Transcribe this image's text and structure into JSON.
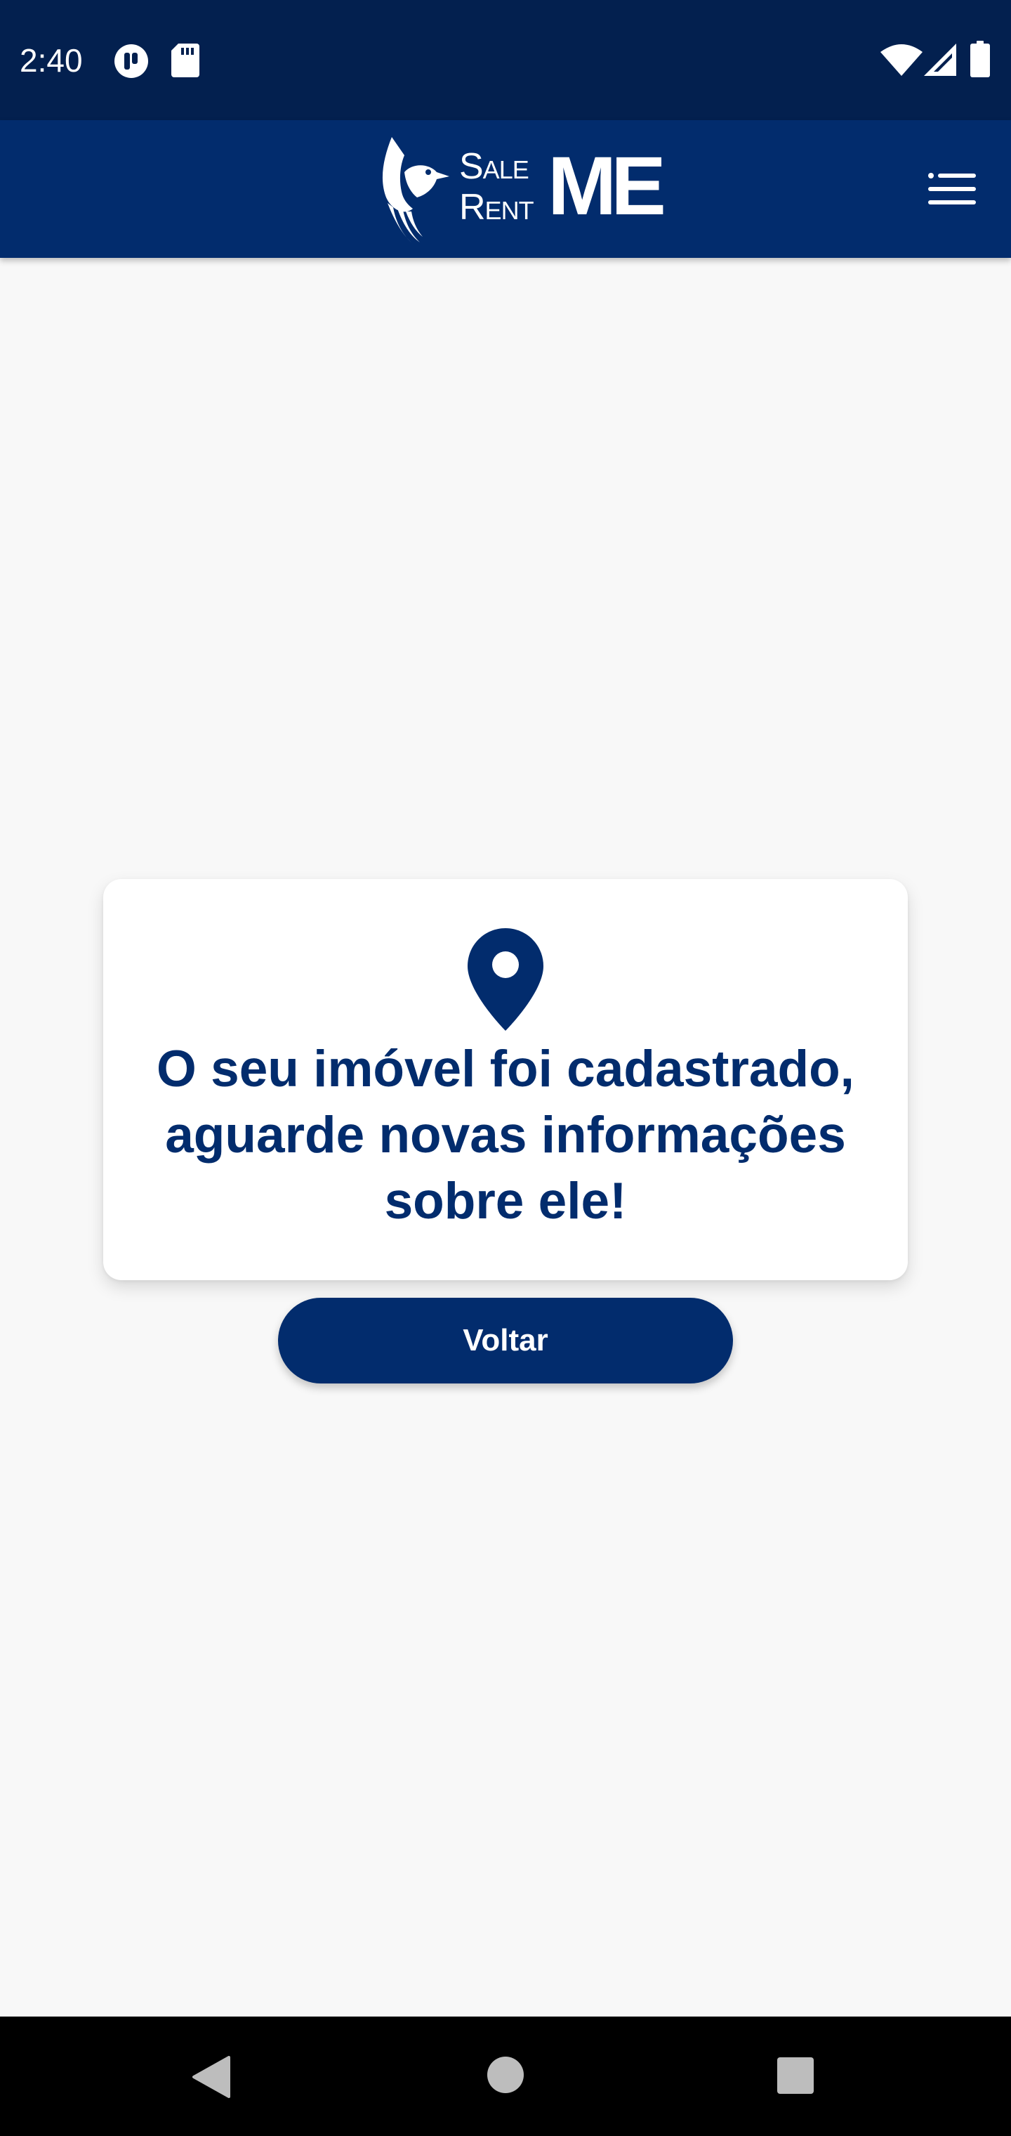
{
  "status_bar": {
    "time": "2:40",
    "left_icons": [
      "pause-circle-icon",
      "sd-card-icon"
    ],
    "right_icons": [
      "wifi-icon",
      "cell-signal-icon",
      "battery-icon"
    ]
  },
  "app_bar": {
    "logo": {
      "line1": "Sale",
      "line2": "Rent",
      "mark": "ME",
      "icon": "hummingbird-logo-icon"
    },
    "menu_icon": "menu-icon"
  },
  "card": {
    "icon": "location-pin-icon",
    "message": "O seu imóvel foi cadastrado, aguarde novas informações sobre ele!"
  },
  "actions": {
    "back_label": "Voltar"
  },
  "nav_bar": {
    "icons": [
      "back-triangle-icon",
      "home-circle-icon",
      "recents-square-icon"
    ]
  },
  "colors": {
    "status_bar_bg": "#03204f",
    "app_bar_bg": "#022c6d",
    "accent": "#022c6d",
    "page_bg": "#f8f8f8",
    "card_bg": "#ffffff"
  }
}
